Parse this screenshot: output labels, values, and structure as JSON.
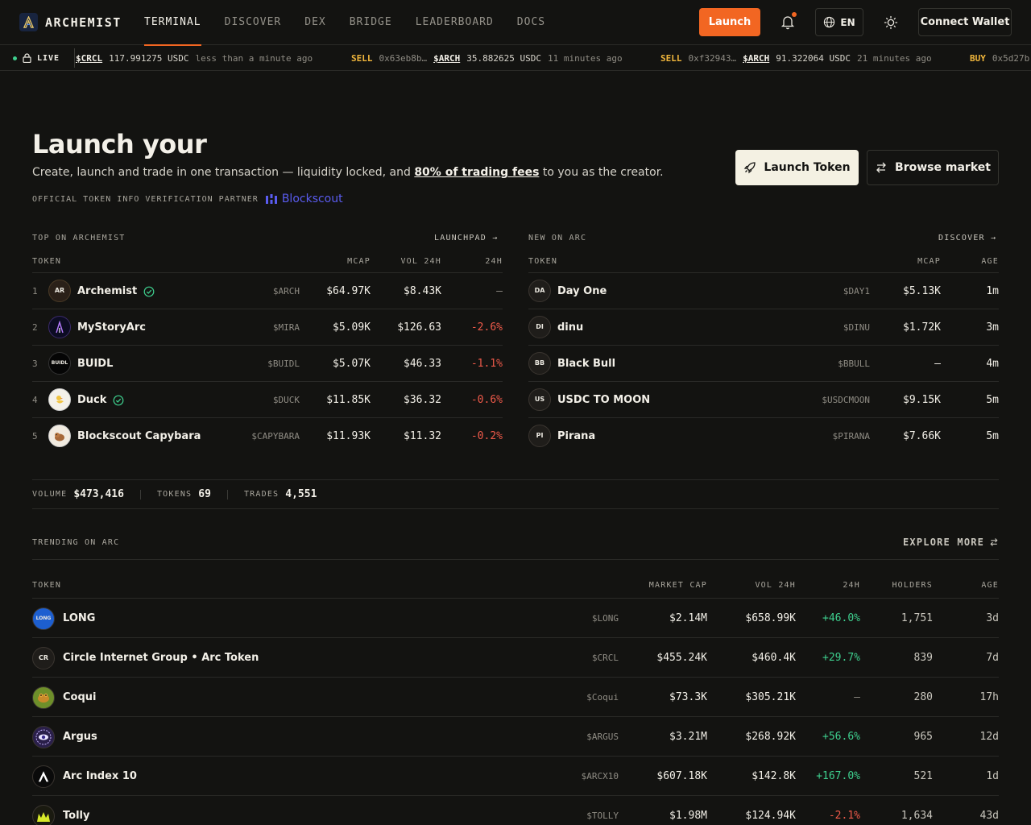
{
  "nav": {
    "brand": "ARCHEMIST",
    "links": [
      "TERMINAL",
      "DISCOVER",
      "DEX",
      "BRIDGE",
      "LEADERBOARD",
      "DOCS"
    ],
    "launch_label": "Launch",
    "lang_label": "EN",
    "wallet_label": "Connect Wallet",
    "accent": "#f26622"
  },
  "ticker": {
    "live_label": "LIVE",
    "items": [
      {
        "side": "",
        "addr": "",
        "sym": "$CRCL",
        "amount": "117.991275 USDC",
        "time": "less than a minute ago"
      },
      {
        "side": "SELL",
        "addr": "0x63eb8b…",
        "sym": "$ARCH",
        "amount": "35.882625 USDC",
        "time": "11 minutes ago"
      },
      {
        "side": "SELL",
        "addr": "0xf32943…",
        "sym": "$ARCH",
        "amount": "91.322064 USDC",
        "time": "21 minutes ago"
      },
      {
        "side": "BUY",
        "addr": "0x5d27b",
        "sym": "",
        "amount": "",
        "time": ""
      }
    ]
  },
  "hero": {
    "title": "Launch your",
    "desc_pre": "Create, launch and trade in one transaction — liquidity locked, and ",
    "desc_bold": "80% of trading fees",
    "desc_post": " to you as the creator.",
    "partner_label": "OFFICIAL TOKEN INFO VERIFICATION PARTNER",
    "partner_brand": "Blockscout",
    "primary_label": "Launch Token",
    "secondary_label": "Browse market"
  },
  "top": {
    "title": "TOP ON ARCHEMIST",
    "link": "LAUNCHPAD →",
    "cols": [
      "TOKEN",
      "MCAP",
      "VOL 24H",
      "24H"
    ],
    "rows": [
      {
        "rank": "1",
        "initials": "AR",
        "name": "Archemist",
        "verified": true,
        "sym": "$ARCH",
        "mcap": "$64.97K",
        "vol": "$8.43K",
        "chg": "—"
      },
      {
        "rank": "2",
        "initials": "",
        "name": "MyStoryArc",
        "verified": false,
        "sym": "$MIRA",
        "mcap": "$5.09K",
        "vol": "$126.63",
        "chg": "-2.6%"
      },
      {
        "rank": "3",
        "initials": "BUIDL",
        "name": "BUIDL",
        "verified": false,
        "sym": "$BUIDL",
        "mcap": "$5.07K",
        "vol": "$46.33",
        "chg": "-1.1%"
      },
      {
        "rank": "4",
        "initials": "",
        "name": "Duck",
        "verified": true,
        "sym": "$DUCK",
        "mcap": "$11.85K",
        "vol": "$36.32",
        "chg": "-0.6%"
      },
      {
        "rank": "5",
        "initials": "",
        "name": "Blockscout Capybara",
        "verified": false,
        "sym": "$CAPYBARA",
        "mcap": "$11.93K",
        "vol": "$11.32",
        "chg": "-0.2%"
      }
    ]
  },
  "new": {
    "title": "NEW ON ARC",
    "link": "DISCOVER →",
    "cols": [
      "TOKEN",
      "MCAP",
      "AGE"
    ],
    "rows": [
      {
        "initials": "DA",
        "name": "Day One",
        "sym": "$DAY1",
        "mcap": "$5.13K",
        "age": "1m"
      },
      {
        "initials": "DI",
        "name": "dinu",
        "sym": "$DINU",
        "mcap": "$1.72K",
        "age": "3m"
      },
      {
        "initials": "BB",
        "name": "Black Bull",
        "sym": "$BBULL",
        "mcap": "—",
        "age": "4m"
      },
      {
        "initials": "US",
        "name": "USDC TO MOON",
        "sym": "$USDCMOON",
        "mcap": "$9.15K",
        "age": "5m"
      },
      {
        "initials": "PI",
        "name": "Pirana",
        "sym": "$PIRANA",
        "mcap": "$7.66K",
        "age": "5m"
      }
    ]
  },
  "stats": [
    {
      "label": "VOLUME",
      "value": "$473,416"
    },
    {
      "label": "TOKENS",
      "value": "69"
    },
    {
      "label": "TRADES",
      "value": "4,551"
    }
  ],
  "trending": {
    "title": "TRENDING ON ARC",
    "link": "EXPLORE MORE",
    "cols": [
      "TOKEN",
      "MARKET CAP",
      "VOL 24H",
      "24H",
      "HOLDERS",
      "AGE"
    ],
    "rows": [
      {
        "initials": "LONG",
        "name": "LONG",
        "sym": "$LONG",
        "mcap": "$2.14M",
        "vol": "$658.99K",
        "chg": "+46.0%",
        "holders": "1,751",
        "age": "3d",
        "bg": "#1d5fd0"
      },
      {
        "initials": "CR",
        "name": "Circle Internet Group • Arc Token",
        "sym": "$CRCL",
        "mcap": "$455.24K",
        "vol": "$460.4K",
        "chg": "+29.7%",
        "holders": "839",
        "age": "7d",
        "bg": "#1f1d1a"
      },
      {
        "initials": "",
        "name": "Coqui",
        "sym": "$Coqui",
        "mcap": "$73.3K",
        "vol": "$305.21K",
        "chg": "—",
        "holders": "280",
        "age": "17h",
        "bg": "#6e8f2a"
      },
      {
        "initials": "",
        "name": "Argus",
        "sym": "$ARGUS",
        "mcap": "$3.21M",
        "vol": "$268.92K",
        "chg": "+56.6%",
        "holders": "965",
        "age": "12d",
        "bg": "#2a1f4a"
      },
      {
        "initials": "",
        "name": "Arc Index 10",
        "sym": "$ARCX10",
        "mcap": "$607.18K",
        "vol": "$142.8K",
        "chg": "+167.0%",
        "holders": "521",
        "age": "1d",
        "bg": "#0a0a0a"
      },
      {
        "initials": "",
        "name": "Tolly",
        "sym": "$TOLLY",
        "mcap": "$1.98M",
        "vol": "$124.94K",
        "chg": "-2.1%",
        "holders": "1,634",
        "age": "43d",
        "bg": "#1a1a10"
      }
    ]
  }
}
